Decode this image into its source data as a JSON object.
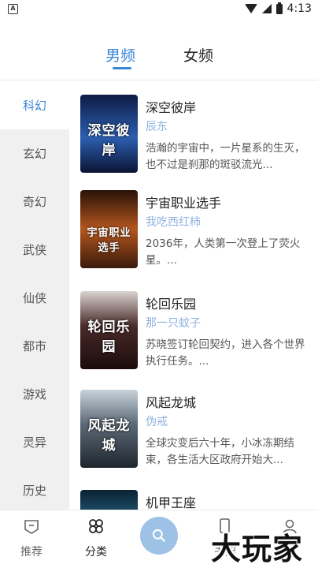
{
  "status_bar": {
    "time": "4:13",
    "app_badge": "A"
  },
  "top_tabs": [
    {
      "label": "男频",
      "active": true
    },
    {
      "label": "女频",
      "active": false
    }
  ],
  "categories": [
    {
      "label": "科幻",
      "active": true
    },
    {
      "label": "玄幻",
      "active": false
    },
    {
      "label": "奇幻",
      "active": false
    },
    {
      "label": "武侠",
      "active": false
    },
    {
      "label": "仙侠",
      "active": false
    },
    {
      "label": "都市",
      "active": false
    },
    {
      "label": "游戏",
      "active": false
    },
    {
      "label": "灵异",
      "active": false
    },
    {
      "label": "历史",
      "active": false
    }
  ],
  "books": [
    {
      "title": "深空彼岸",
      "author": "辰东",
      "desc": "浩瀚的宇宙中，一片星系的生灭，也不过是刹那的斑驳流光...",
      "cover_text": "深空彼岸",
      "cover_color": "#1e3a7a"
    },
    {
      "title": "宇宙职业选手",
      "author": "我吃西红柿",
      "desc": "2036年，人类第一次登上了荧火星。...",
      "cover_text": "宇宙职业选手",
      "cover_color": "#7a3414"
    },
    {
      "title": "轮回乐园",
      "author": "那一只蚊子",
      "desc": "苏晓签订轮回契约，进入各个世界执行任务。...",
      "cover_text": "轮回乐园",
      "cover_color": "#3a2a2a"
    },
    {
      "title": "风起龙城",
      "author": "伪戒",
      "desc": "全球灾变后六十年，小冰冻期结束，各生活大区政府开始大...",
      "cover_text": "风起龙城",
      "cover_color": "#4b5865"
    },
    {
      "title": "机甲王座",
      "author": "",
      "desc": "",
      "cover_text": "",
      "cover_color": "#1d4f6b"
    }
  ],
  "bottom_nav": {
    "recommend": "推荐",
    "category": "分类",
    "bookshelf": "书架",
    "watermark": "大玩家"
  },
  "accent_color": "#3a86d6"
}
